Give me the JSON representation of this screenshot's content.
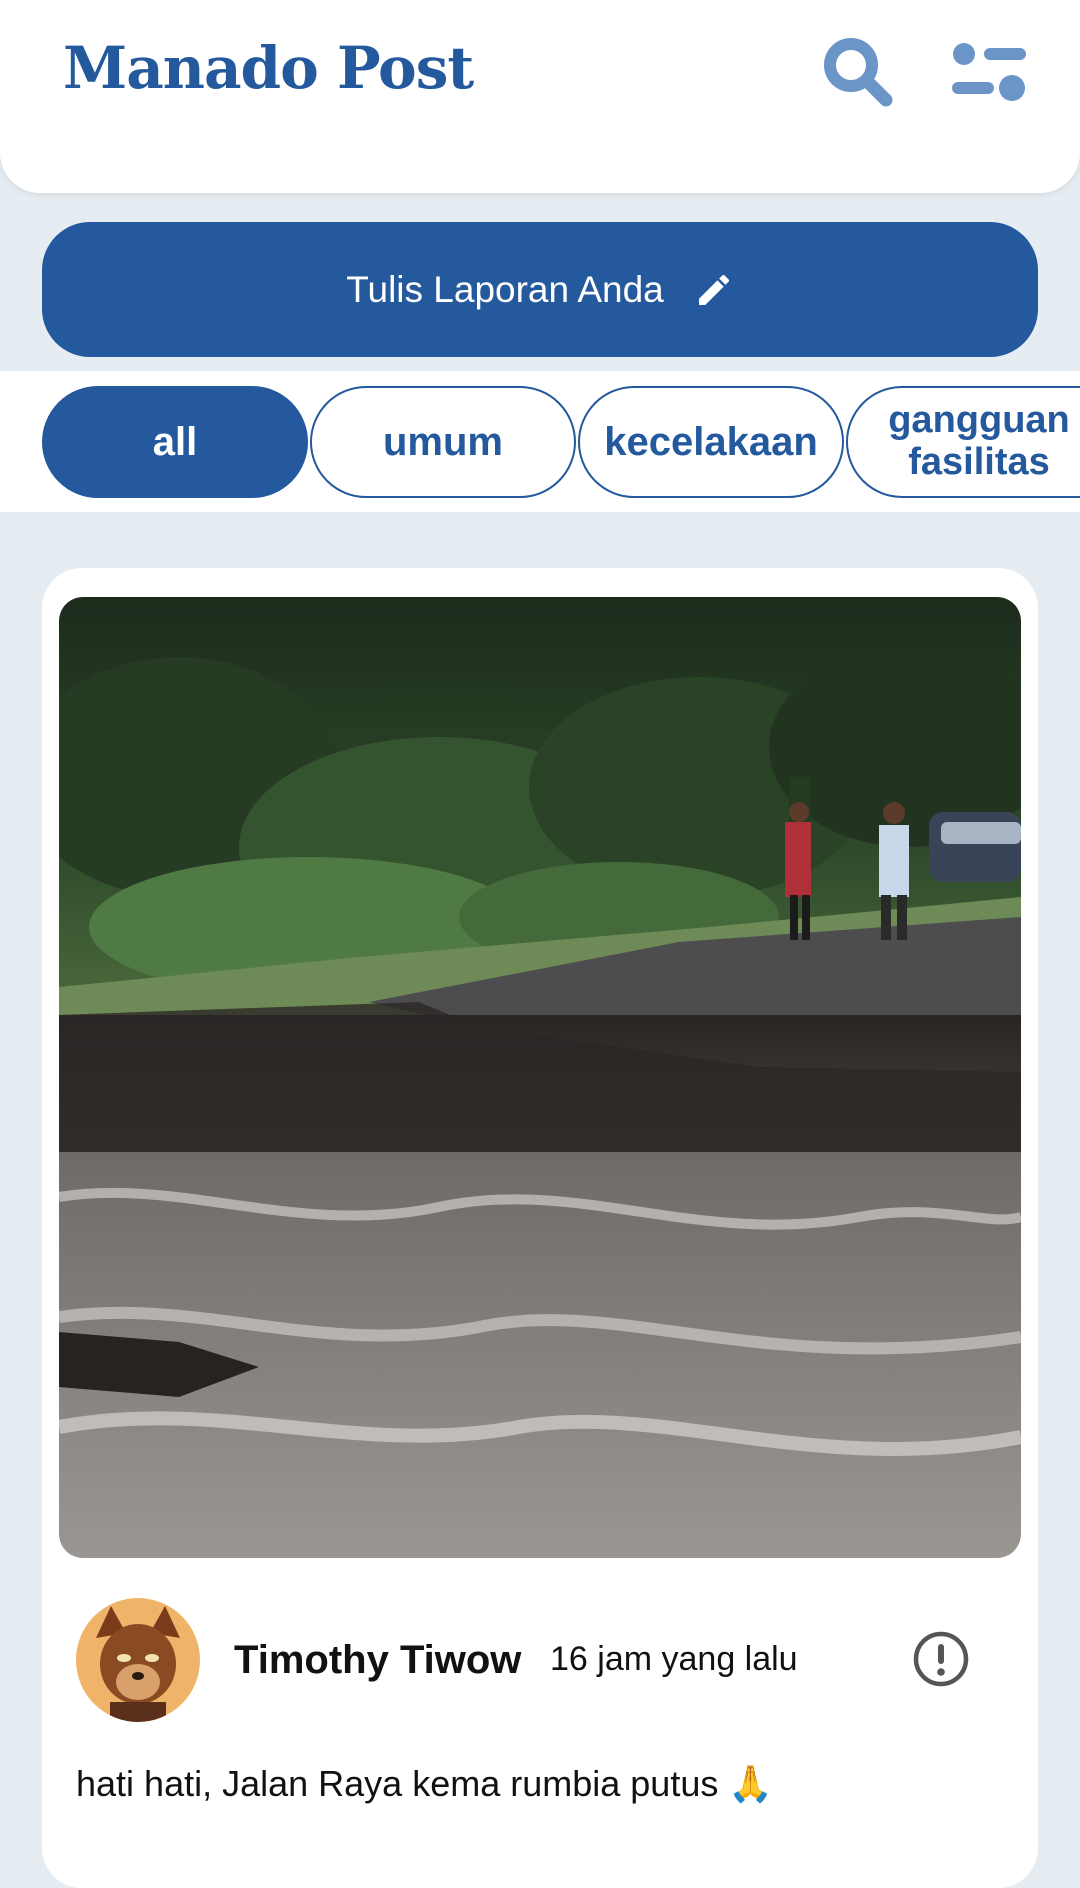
{
  "header": {
    "brand": "Manado Post",
    "search_icon": "search-icon",
    "filter_icon": "filter-icon",
    "brand_color": "#24599d"
  },
  "write_report": {
    "label": "Tulis Laporan Anda",
    "icon": "pencil-icon"
  },
  "categories": [
    {
      "label": "all",
      "active": true
    },
    {
      "label": "umum",
      "active": false
    },
    {
      "label": "kecelakaan",
      "active": false
    },
    {
      "label": "gangguan fasilitas",
      "active": false
    }
  ],
  "post": {
    "image_icon": "road-damage-photo",
    "author": "Timothy Tiwow",
    "time": "16 jam yang lalu",
    "report_icon": "alert-circle-icon",
    "text": "hati hati, Jalan Raya kema rumbia putus 🙏"
  }
}
